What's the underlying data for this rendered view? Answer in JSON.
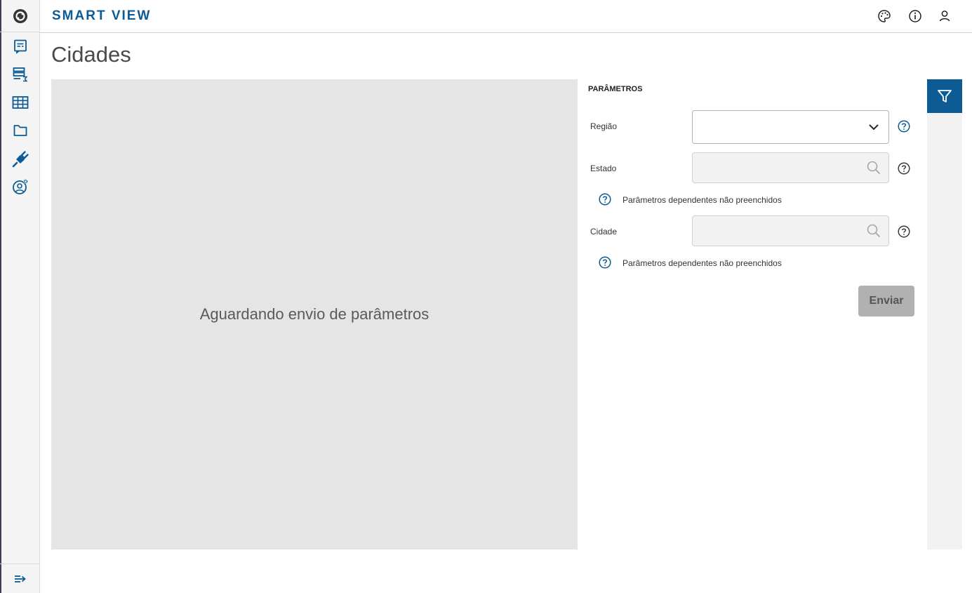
{
  "colors": {
    "brand": "#0c5b95",
    "rail_bg": "#f4f4f4",
    "placeholder_bg": "#e5e5e5",
    "disabled_button": "#b1b1b1"
  },
  "header": {
    "brand": "SMART VIEW",
    "icons": [
      "palette-icon",
      "info-icon",
      "user-icon"
    ]
  },
  "sidebar": {
    "items": [
      "report-icon",
      "report-sum-icon",
      "table-icon",
      "folder-icon",
      "plug-icon",
      "user-settings-icon"
    ],
    "bottom": "expand-menu-icon"
  },
  "page": {
    "title": "Cidades"
  },
  "content": {
    "placeholder_text": "Aguardando envio de parâmetros"
  },
  "params": {
    "title": "PARÂMETROS",
    "fields": [
      {
        "label": "Região",
        "value": "",
        "type": "select"
      },
      {
        "label": "Estado",
        "value": "",
        "type": "lookup",
        "note": "Parâmetros dependentes não preenchidos"
      },
      {
        "label": "Cidade",
        "value": "",
        "type": "lookup",
        "note": "Parâmetros dependentes não preenchidos"
      }
    ],
    "submit_label": "Enviar"
  }
}
